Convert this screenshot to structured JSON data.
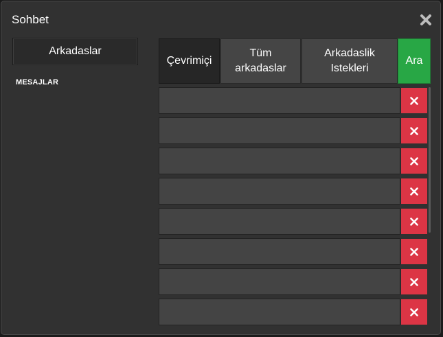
{
  "window": {
    "title": "Sohbet",
    "close_icon": "close-icon"
  },
  "sidebar": {
    "friends_button": "Arkadaslar",
    "messages_heading": "MESAJLAR"
  },
  "tabs": [
    {
      "label": "Çevrimiçi",
      "state": "active"
    },
    {
      "label": "Tüm arkadaslar",
      "state": "normal"
    },
    {
      "label": "Arkadaslik Istekleri",
      "state": "normal"
    },
    {
      "label": "Ara",
      "state": "search"
    }
  ],
  "friend_rows": [
    {
      "name": "",
      "remove_icon": "close-icon"
    },
    {
      "name": "",
      "remove_icon": "close-icon"
    },
    {
      "name": "",
      "remove_icon": "close-icon"
    },
    {
      "name": "",
      "remove_icon": "close-icon"
    },
    {
      "name": "",
      "remove_icon": "close-icon"
    },
    {
      "name": "",
      "remove_icon": "close-icon"
    },
    {
      "name": "",
      "remove_icon": "close-icon"
    },
    {
      "name": "",
      "remove_icon": "close-icon"
    }
  ],
  "colors": {
    "background": "#313131",
    "tab_active": "#262626",
    "tab_normal": "#454545",
    "search_green": "#28a745",
    "remove_red": "#dc3545",
    "row_bg": "#444444",
    "text": "#ffffff"
  }
}
